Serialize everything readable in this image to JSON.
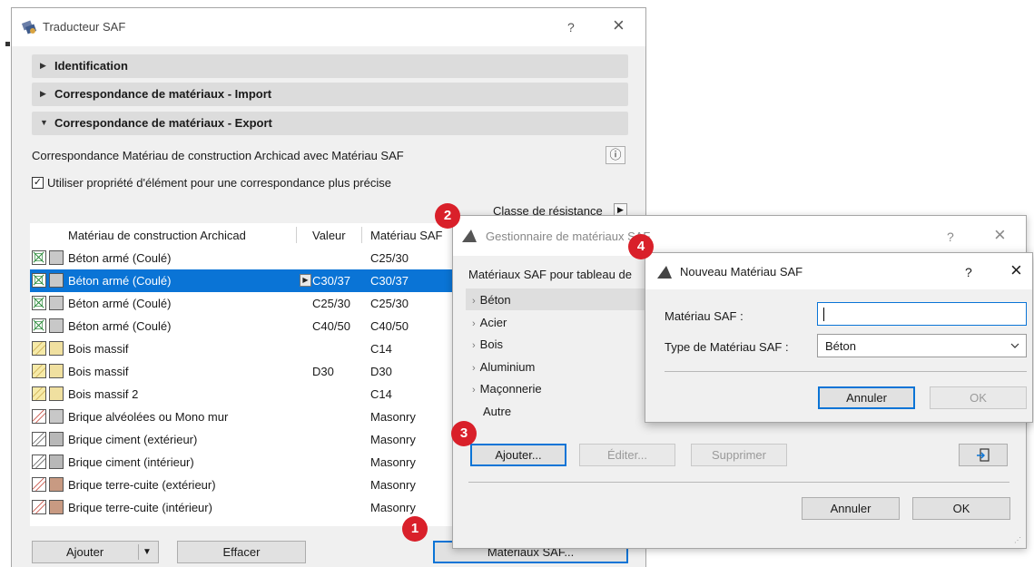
{
  "win1": {
    "title": "Traducteur SAF",
    "help": "?",
    "close": "×",
    "sections": [
      "Identification",
      "Correspondance de matériaux - Import",
      "Correspondance de matériaux - Export"
    ],
    "description": "Correspondance Matériau de construction Archicad avec Matériau SAF",
    "info": "ⓘ",
    "checkbox_label": "Utiliser propriété d'élément pour une correspondance plus précise",
    "checkbox_mark": "✓",
    "class_label": "Classe de résistance",
    "class_arrow": "▶",
    "columns": [
      "Matériau de construction Archicad",
      "Valeur",
      "Matériau SAF"
    ],
    "rows": [
      {
        "name": "Béton armé (Coulé)",
        "valeur": "",
        "saf": "C25/30",
        "pattern": "concrete",
        "color": "#c8c8c8"
      },
      {
        "name": "Béton armé (Coulé)",
        "valeur": "C30/37",
        "saf": "C30/37",
        "pattern": "concrete",
        "color": "#c8c8c8"
      },
      {
        "name": "Béton armé (Coulé)",
        "valeur": "C25/30",
        "saf": "C25/30",
        "pattern": "concrete",
        "color": "#c8c8c8"
      },
      {
        "name": "Béton armé (Coulé)",
        "valeur": "C40/50",
        "saf": "C40/50",
        "pattern": "concrete",
        "color": "#c8c8c8"
      },
      {
        "name": "Bois massif",
        "valeur": "",
        "saf": "C14",
        "pattern": "wood",
        "color": "#f0e0a0"
      },
      {
        "name": "Bois massif",
        "valeur": "D30",
        "saf": "D30",
        "pattern": "wood",
        "color": "#f0e0a0"
      },
      {
        "name": "Bois massif 2",
        "valeur": "",
        "saf": "C14",
        "pattern": "wood",
        "color": "#f0e0a0"
      },
      {
        "name": "Brique alvéolées ou Mono mur",
        "valeur": "",
        "saf": "Masonry",
        "pattern": "brick-red",
        "color": "#c8c8c8"
      },
      {
        "name": "Brique ciment (extérieur)",
        "valeur": "",
        "saf": "Masonry",
        "pattern": "brick",
        "color": "#b8b8b8"
      },
      {
        "name": "Brique ciment (intérieur)",
        "valeur": "",
        "saf": "Masonry",
        "pattern": "brick",
        "color": "#b8b8b8"
      },
      {
        "name": "Brique terre-cuite (extérieur)",
        "valeur": "",
        "saf": "Masonry",
        "pattern": "brick-red",
        "color": "#c89a82"
      },
      {
        "name": "Brique terre-cuite (intérieur)",
        "valeur": "",
        "saf": "Masonry",
        "pattern": "brick-red",
        "color": "#c89a82"
      }
    ],
    "selected_row": 1,
    "btn_add": "Ajouter",
    "btn_add_dropdown": "▼",
    "btn_clear": "Effacer",
    "btn_saf": "Matériaux SAF..."
  },
  "win2": {
    "title": "Gestionnaire de matériaux SAF",
    "help": "?",
    "close": "×",
    "list_label": "Matériaux SAF pour tableau de",
    "materials": [
      "Béton",
      "Acier",
      "Bois",
      "Aluminium",
      "Maçonnerie",
      "Autre"
    ],
    "chevron": "›",
    "btn_add": "Ajouter...",
    "btn_edit": "Éditer...",
    "btn_delete": "Supprimer",
    "btn_cancel": "Annuler",
    "btn_ok": "OK"
  },
  "win3": {
    "title": "Nouveau Matériau SAF",
    "help": "?",
    "close": "×",
    "label_material": "Matériau SAF :",
    "material_value": "",
    "label_type": "Type de Matériau SAF :",
    "type_value": "Béton",
    "btn_cancel": "Annuler",
    "btn_ok": "OK"
  },
  "badges": [
    "1",
    "2",
    "3",
    "4"
  ],
  "colors": {
    "accent": "#0a74d6",
    "badge": "#d9202a"
  }
}
